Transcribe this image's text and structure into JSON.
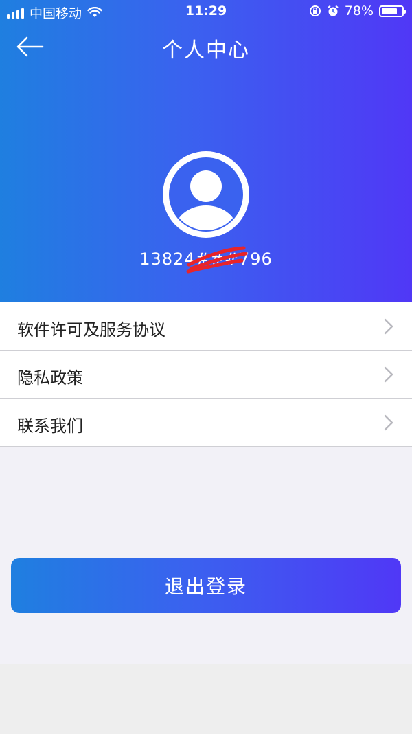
{
  "status_bar": {
    "carrier": "中国移动",
    "time": "11:29",
    "battery_percent": "78%",
    "battery_level": 0.78,
    "icons": [
      "signal-icon",
      "wifi-icon",
      "orientation-lock-icon",
      "alarm-icon",
      "battery-icon"
    ]
  },
  "nav": {
    "title": "个人中心",
    "back_icon": "arrow-left-icon"
  },
  "profile": {
    "avatar_icon": "user-avatar-icon",
    "phone": "13824###796"
  },
  "menu": {
    "items": [
      {
        "label": "软件许可及服务协议",
        "icon": "chevron-right-icon"
      },
      {
        "label": "隐私政策",
        "icon": "chevron-right-icon"
      },
      {
        "label": "联系我们",
        "icon": "chevron-right-icon"
      }
    ]
  },
  "logout": {
    "label": "退出登录"
  },
  "colors": {
    "gradient_start": "#1f7fe0",
    "gradient_end": "#5038f6",
    "page_bg": "#f2f1f7",
    "redaction": "#e8242a"
  }
}
